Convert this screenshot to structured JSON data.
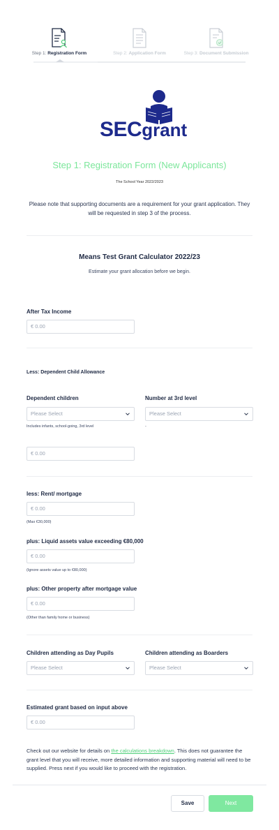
{
  "stepper": {
    "steps": [
      {
        "num": "Step 1:",
        "title": "Registration Form",
        "state": "active"
      },
      {
        "num": "Step 2:",
        "title": "Application Form",
        "state": "inactive"
      },
      {
        "num": "Step 3:",
        "title": "Document Submission",
        "state": "inactive"
      }
    ]
  },
  "logo": {
    "sec": "SEC",
    "grant": "grant",
    "brand_color": "#1d2a8c"
  },
  "header": {
    "title": "Step 1: Registration Form (New Applicants)",
    "subtitle": "The School Year 2022/2023",
    "note": "Please note that supporting documents are a requirement for your grant application. They will be requested in step 3 of the process."
  },
  "calculator": {
    "title": "Means Test Grant Calculator 2022/23",
    "subtitle": "Estimate your grant allocation before we begin."
  },
  "fields": {
    "after_tax": {
      "label": "After Tax Income",
      "placeholder": "€ 0.00"
    },
    "section_child": "Less: Dependent Child Allowance",
    "dependent_children": {
      "label": "Dependent children",
      "placeholder": "Please Select",
      "help": "Includes infants, school-going, 3rd level"
    },
    "third_level": {
      "label": "Number at 3rd level",
      "placeholder": "Please Select",
      "help": "-"
    },
    "child_allowance": {
      "placeholder": "€ 0.00"
    },
    "rent": {
      "label": "less: Rent/ mortgage",
      "placeholder": "€ 0.00",
      "help": "(Max €30,000)"
    },
    "liquid": {
      "label": "plus: Liquid assets value exceeding €80,000",
      "placeholder": "€ 0.00",
      "help": "(Ignore assets value up to €80,000)"
    },
    "property": {
      "label": "plus: Other property after mortgage value",
      "placeholder": "€ 0.00",
      "help": "(Other than family home or business)"
    },
    "day_pupils": {
      "label": "Children attending as Day Pupils",
      "placeholder": "Please Select"
    },
    "boarders": {
      "label": "Children attending as Boarders",
      "placeholder": "Please Select"
    },
    "estimate": {
      "label": "Estimated grant based on input above",
      "placeholder": "€ 0.00"
    }
  },
  "footer": {
    "text_before": "Check out our website for details on ",
    "link": "the calculations breakdown",
    "text_after": ". This does not guarantee the grant level that you will receive, more detailed information and supporting material will need to be supplied. Press next if you would like to proceed with the registration."
  },
  "buttons": {
    "save": "Save",
    "next": "Next"
  },
  "colors": {
    "accent": "#7be69a",
    "next_button": "#7fe8a0",
    "text": "#1f2a44"
  },
  "icons": [
    "document-user-icon",
    "document-lines-icon",
    "document-check-icon",
    "chevron-down-icon"
  ]
}
